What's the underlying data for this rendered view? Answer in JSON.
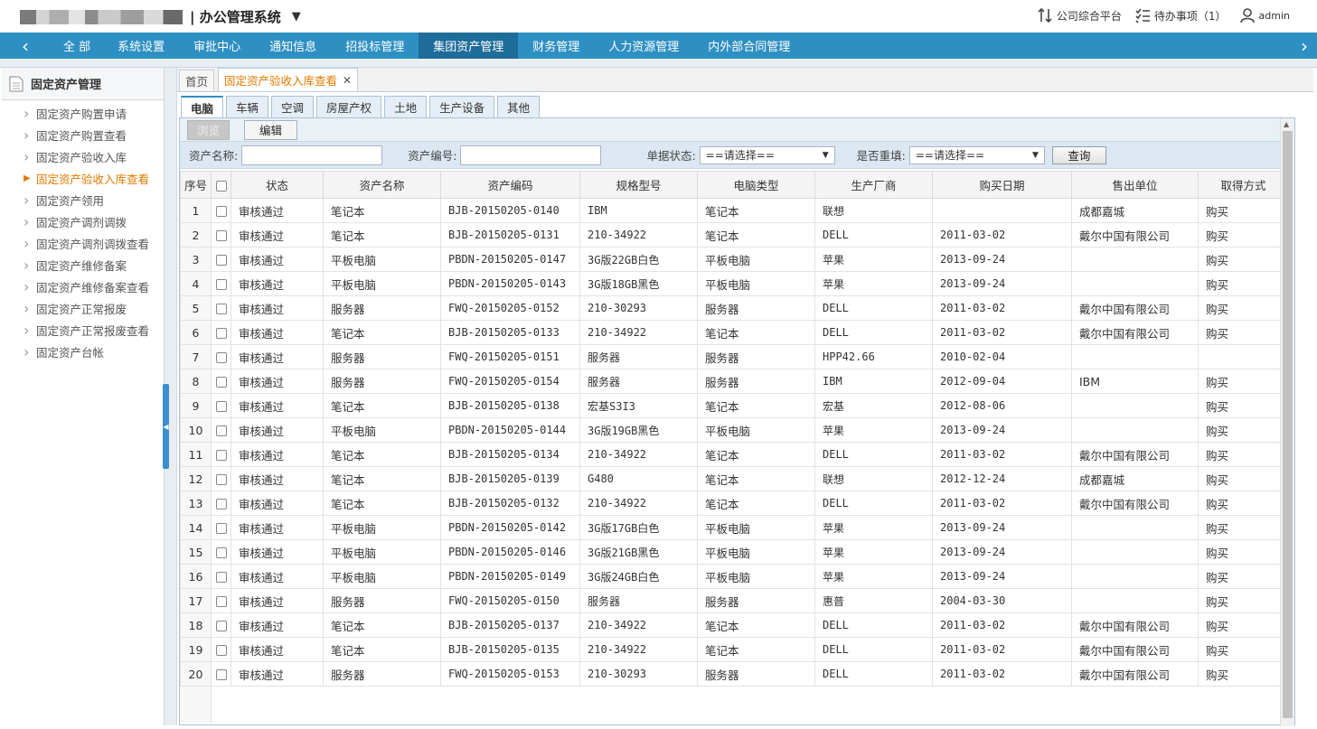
{
  "header": {
    "system_title": "| 办公管理系统",
    "caret": "▼",
    "links": [
      {
        "label": "公司综合平台"
      },
      {
        "label": "待办事项（1）"
      },
      {
        "label": "admin"
      }
    ]
  },
  "nav": {
    "items": [
      "全 部",
      "系统设置",
      "审批中心",
      "通知信息",
      "招投标管理",
      "集团资产管理",
      "财务管理",
      "人力资源管理",
      "内外部合同管理"
    ],
    "active": "集团资产管理"
  },
  "sidebar": {
    "title": "固定资产管理",
    "items": [
      {
        "label": "固定资产购置申请"
      },
      {
        "label": "固定资产购置查看"
      },
      {
        "label": "固定资产验收入库"
      },
      {
        "label": "固定资产验收入库查看"
      },
      {
        "label": "固定资产领用"
      },
      {
        "label": "固定资产调剂调拨"
      },
      {
        "label": "固定资产调剂调拨查看"
      },
      {
        "label": "固定资产维修备案"
      },
      {
        "label": "固定资产维修备案查看"
      },
      {
        "label": "固定资产正常报废"
      },
      {
        "label": "固定资产正常报废查看"
      },
      {
        "label": "固定资产台帐"
      }
    ],
    "active_index": 3
  },
  "tabs": {
    "home": "首页",
    "current": "固定资产验收入库查看",
    "close": "✕"
  },
  "subtabs": [
    "电脑",
    "车辆",
    "空调",
    "房屋产权",
    "土地",
    "生产设备",
    "其他"
  ],
  "toolbar": {
    "browse": "浏览",
    "edit": "编辑"
  },
  "filter": {
    "asset_name_label": "资产名称:",
    "asset_code_label": "资产编号:",
    "doc_status_label": "单据状态:",
    "doc_status_value": "==请选择==",
    "repeat_label": "是否重填:",
    "repeat_value": "==请选择==",
    "query": "查询"
  },
  "table": {
    "columns": [
      "序号",
      "",
      "状态",
      "资产名称",
      "资产编码",
      "规格型号",
      "电脑类型",
      "生产厂商",
      "购买日期",
      "售出单位",
      "取得方式"
    ],
    "rows": [
      [
        "1",
        "审核通过",
        "笔记本",
        "BJB-20150205-0140",
        "IBM",
        "笔记本",
        "联想",
        "",
        "成都嘉城",
        "购买"
      ],
      [
        "2",
        "审核通过",
        "笔记本",
        "BJB-20150205-0131",
        "210-34922",
        "笔记本",
        "DELL",
        "2011-03-02",
        "戴尔中国有限公司",
        "购买"
      ],
      [
        "3",
        "审核通过",
        "平板电脑",
        "PBDN-20150205-0147",
        "3G版22GB白色",
        "平板电脑",
        "苹果",
        "2013-09-24",
        "",
        "购买"
      ],
      [
        "4",
        "审核通过",
        "平板电脑",
        "PBDN-20150205-0143",
        "3G版18GB黑色",
        "平板电脑",
        "苹果",
        "2013-09-24",
        "",
        "购买"
      ],
      [
        "5",
        "审核通过",
        "服务器",
        "FWQ-20150205-0152",
        "210-30293",
        "服务器",
        "DELL",
        "2011-03-02",
        "戴尔中国有限公司",
        "购买"
      ],
      [
        "6",
        "审核通过",
        "笔记本",
        "BJB-20150205-0133",
        "210-34922",
        "笔记本",
        "DELL",
        "2011-03-02",
        "戴尔中国有限公司",
        "购买"
      ],
      [
        "7",
        "审核通过",
        "服务器",
        "FWQ-20150205-0151",
        "服务器",
        "服务器",
        "HPP42.66",
        "2010-02-04",
        "",
        ""
      ],
      [
        "8",
        "审核通过",
        "服务器",
        "FWQ-20150205-0154",
        "服务器",
        "服务器",
        "IBM",
        "2012-09-04",
        "IBM",
        "购买"
      ],
      [
        "9",
        "审核通过",
        "笔记本",
        "BJB-20150205-0138",
        "宏基S3I3",
        "笔记本",
        "宏基",
        "2012-08-06",
        "",
        "购买"
      ],
      [
        "10",
        "审核通过",
        "平板电脑",
        "PBDN-20150205-0144",
        "3G版19GB黑色",
        "平板电脑",
        "苹果",
        "2013-09-24",
        "",
        "购买"
      ],
      [
        "11",
        "审核通过",
        "笔记本",
        "BJB-20150205-0134",
        "210-34922",
        "笔记本",
        "DELL",
        "2011-03-02",
        "戴尔中国有限公司",
        "购买"
      ],
      [
        "12",
        "审核通过",
        "笔记本",
        "BJB-20150205-0139",
        "G480",
        "笔记本",
        "联想",
        "2012-12-24",
        "成都嘉城",
        "购买"
      ],
      [
        "13",
        "审核通过",
        "笔记本",
        "BJB-20150205-0132",
        "210-34922",
        "笔记本",
        "DELL",
        "2011-03-02",
        "戴尔中国有限公司",
        "购买"
      ],
      [
        "14",
        "审核通过",
        "平板电脑",
        "PBDN-20150205-0142",
        "3G版17GB白色",
        "平板电脑",
        "苹果",
        "2013-09-24",
        "",
        "购买"
      ],
      [
        "15",
        "审核通过",
        "平板电脑",
        "PBDN-20150205-0146",
        "3G版21GB黑色",
        "平板电脑",
        "苹果",
        "2013-09-24",
        "",
        "购买"
      ],
      [
        "16",
        "审核通过",
        "平板电脑",
        "PBDN-20150205-0149",
        "3G版24GB白色",
        "平板电脑",
        "苹果",
        "2013-09-24",
        "",
        "购买"
      ],
      [
        "17",
        "审核通过",
        "服务器",
        "FWQ-20150205-0150",
        "服务器",
        "服务器",
        "惠普",
        "2004-03-30",
        "",
        "购买"
      ],
      [
        "18",
        "审核通过",
        "笔记本",
        "BJB-20150205-0137",
        "210-34922",
        "笔记本",
        "DELL",
        "2011-03-02",
        "戴尔中国有限公司",
        "购买"
      ],
      [
        "19",
        "审核通过",
        "笔记本",
        "BJB-20150205-0135",
        "210-34922",
        "笔记本",
        "DELL",
        "2011-03-02",
        "戴尔中国有限公司",
        "购买"
      ],
      [
        "20",
        "审核通过",
        "服务器",
        "FWQ-20150205-0153",
        "210-30293",
        "服务器",
        "DELL",
        "2011-03-02",
        "戴尔中国有限公司",
        "购买"
      ]
    ]
  },
  "colors": {
    "nav_bg": "#2e8fc2",
    "nav_active": "#1e6c9a",
    "active_text": "#e07b00"
  }
}
